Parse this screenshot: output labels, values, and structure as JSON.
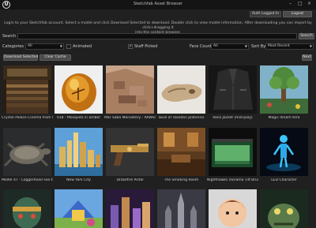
{
  "window": {
    "title": "Sketchfab Asset Browser",
    "logo_letter": "U",
    "minimize": "–",
    "maximize": "□",
    "close": "×"
  },
  "header": {
    "status": "Auth Logged In",
    "logout_label": "Logout",
    "instructions_line1": "Login to your Sketchfab account. Select a model and click Download Selected to download. Double click to view model information. After downloading you can import by click+dragging it",
    "instructions_line2": "into the content browser."
  },
  "search": {
    "label": "Search",
    "value": "",
    "button_label": "Search"
  },
  "filters": {
    "categories_label": "Categories",
    "categories_value": "All",
    "animated_label": "Animated",
    "animated_checked": false,
    "staff_picked_label": "Staff Picked",
    "staff_picked_checked": true,
    "face_count_label": "Face Count",
    "face_count_value": "All",
    "sort_by_label": "Sort By",
    "sort_by_value": "Most Recent"
  },
  "actions": {
    "download_selected": "Download Selected",
    "clear_cache": "Clear Cache",
    "next": "Next"
  },
  "models": [
    {
      "name": "Crystal Palace Cinema from realityvirtual.co",
      "thumb": "cinema-hall"
    },
    {
      "name": "018 - Mosquito in amber",
      "thumb": "amber-stone"
    },
    {
      "name": "Mar Saba Monastery - RAWscan",
      "thumb": "monastery"
    },
    {
      "name": "Skull of Toxodon platensis",
      "thumb": "skull"
    },
    {
      "name": "Rock Jacket (mid-poly)",
      "thumb": "jacket"
    },
    {
      "name": "Magic dream tera",
      "thumb": "dream-tree"
    },
    {
      "name": "Model 47 - Loggerhead sea turtle",
      "thumb": "turtle"
    },
    {
      "name": "New York City",
      "thumb": "city"
    },
    {
      "name": "Drakefire Pistol",
      "thumb": "pistol"
    },
    {
      "name": "The Smoking Room",
      "thumb": "room"
    },
    {
      "name": "Nighthawks diorama Tilt Brush",
      "thumb": "diner"
    },
    {
      "name": "LED Character",
      "thumb": "led-figure"
    },
    {
      "name": "",
      "thumb": "robot-head"
    },
    {
      "name": "",
      "thumb": "cartoon-scene"
    },
    {
      "name": "",
      "thumb": "night-city"
    },
    {
      "name": "",
      "thumb": "cathedral"
    },
    {
      "name": "",
      "thumb": "cartoon-boy"
    },
    {
      "name": "",
      "thumb": "monster"
    }
  ]
}
